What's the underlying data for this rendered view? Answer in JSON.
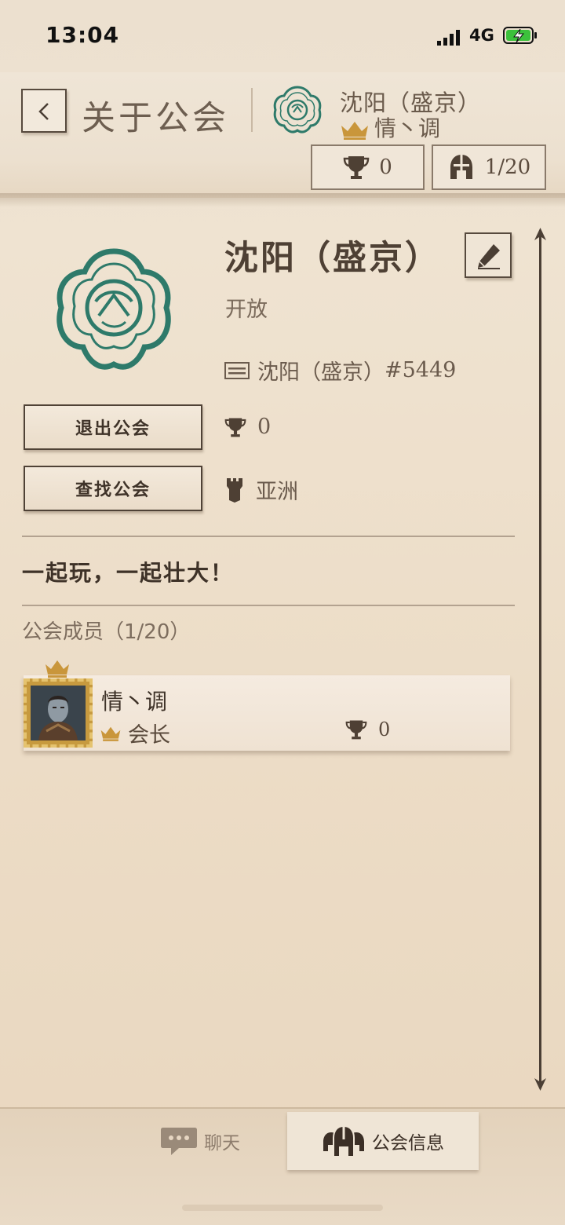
{
  "status_bar": {
    "time": "13:04",
    "network": "4G"
  },
  "header": {
    "title": "关于公会",
    "guild_name": "沈阳（盛京）",
    "leader_name": "情丶调",
    "trophies": "0",
    "members": "1/20"
  },
  "guild": {
    "name": "沈阳（盛京）",
    "status": "开放",
    "tag": "沈阳（盛京）",
    "tag_code": "#5449",
    "trophies": "0",
    "region": "亚洲",
    "motto": "一起玩，一起壮大！",
    "members_title": "公会成员（1/20）"
  },
  "buttons": {
    "leave": "退出公会",
    "find": "查找公会"
  },
  "members": [
    {
      "name": "情丶调",
      "role": "会长",
      "trophies": "0"
    }
  ],
  "tabs": {
    "chat": "聊天",
    "info": "公会信息"
  },
  "colors": {
    "emblem": "#2e7a6a",
    "gold": "#c79a3f",
    "text_dark": "#3e3228"
  }
}
